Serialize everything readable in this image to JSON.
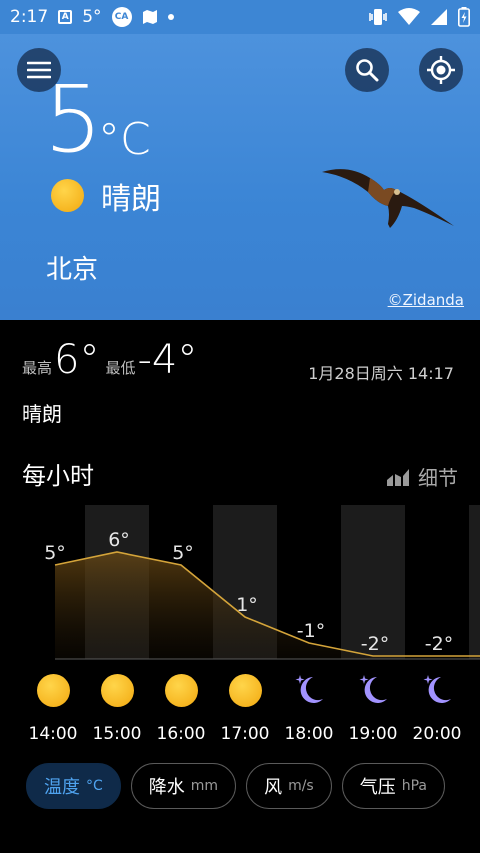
{
  "status_bar": {
    "time": "2:17",
    "temp": "5°"
  },
  "hero": {
    "temperature": "5",
    "unit": "°C",
    "condition": "晴朗",
    "city": "北京",
    "credit": "©Zidanda"
  },
  "summary": {
    "high_label": "最高",
    "high": "6°",
    "low_label": "最低",
    "low": "-4°",
    "date": "1月28日周六 14:17",
    "condition": "晴朗"
  },
  "hourly": {
    "title": "每小时",
    "detail_label": "细节",
    "hours": [
      {
        "time": "14:00",
        "temp": 5,
        "label": "5°",
        "icon": "sun-icon"
      },
      {
        "time": "15:00",
        "temp": 6,
        "label": "6°",
        "icon": "sun-icon"
      },
      {
        "time": "16:00",
        "temp": 5,
        "label": "5°",
        "icon": "sun-icon"
      },
      {
        "time": "17:00",
        "temp": 1,
        "label": "1°",
        "icon": "sun-icon"
      },
      {
        "time": "18:00",
        "temp": -1,
        "label": "-1°",
        "icon": "moon-icon"
      },
      {
        "time": "19:00",
        "temp": -2,
        "label": "-2°",
        "icon": "moon-icon"
      },
      {
        "time": "20:00",
        "temp": -2,
        "label": "-2°",
        "icon": "moon-icon"
      }
    ]
  },
  "chips": [
    {
      "label": "温度",
      "unit": "°C",
      "active": true
    },
    {
      "label": "降水",
      "unit": "mm",
      "active": false
    },
    {
      "label": "风",
      "unit": "m/s",
      "active": false
    },
    {
      "label": "气压",
      "unit": "hPa",
      "active": false
    }
  ],
  "colors": {
    "hero": "#3b85d5",
    "accent": "#4fa3ef",
    "line": "#d4a43a",
    "sun": "#f5b01c",
    "moon": "#9c8cff"
  }
}
